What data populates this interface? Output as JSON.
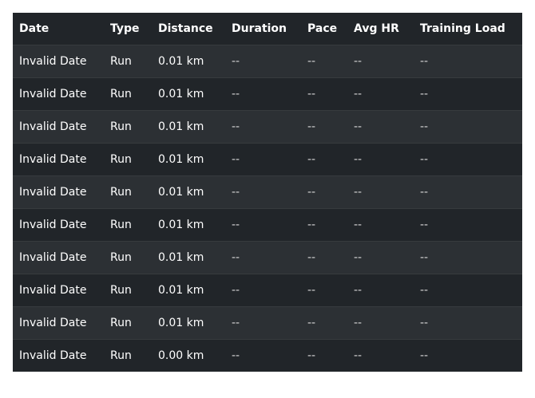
{
  "table": {
    "headers": [
      "Date",
      "Type",
      "Distance",
      "Duration",
      "Pace",
      "Avg HR",
      "Training Load"
    ],
    "rows": [
      [
        "Invalid Date",
        "Run",
        "0.01 km",
        "--",
        "--",
        "--",
        "--"
      ],
      [
        "Invalid Date",
        "Run",
        "0.01 km",
        "--",
        "--",
        "--",
        "--"
      ],
      [
        "Invalid Date",
        "Run",
        "0.01 km",
        "--",
        "--",
        "--",
        "--"
      ],
      [
        "Invalid Date",
        "Run",
        "0.01 km",
        "--",
        "--",
        "--",
        "--"
      ],
      [
        "Invalid Date",
        "Run",
        "0.01 km",
        "--",
        "--",
        "--",
        "--"
      ],
      [
        "Invalid Date",
        "Run",
        "0.01 km",
        "--",
        "--",
        "--",
        "--"
      ],
      [
        "Invalid Date",
        "Run",
        "0.01 km",
        "--",
        "--",
        "--",
        "--"
      ],
      [
        "Invalid Date",
        "Run",
        "0.01 km",
        "--",
        "--",
        "--",
        "--"
      ],
      [
        "Invalid Date",
        "Run",
        "0.01 km",
        "--",
        "--",
        "--",
        "--"
      ],
      [
        "Invalid Date",
        "Run",
        "0.00 km",
        "--",
        "--",
        "--",
        "--"
      ]
    ]
  }
}
